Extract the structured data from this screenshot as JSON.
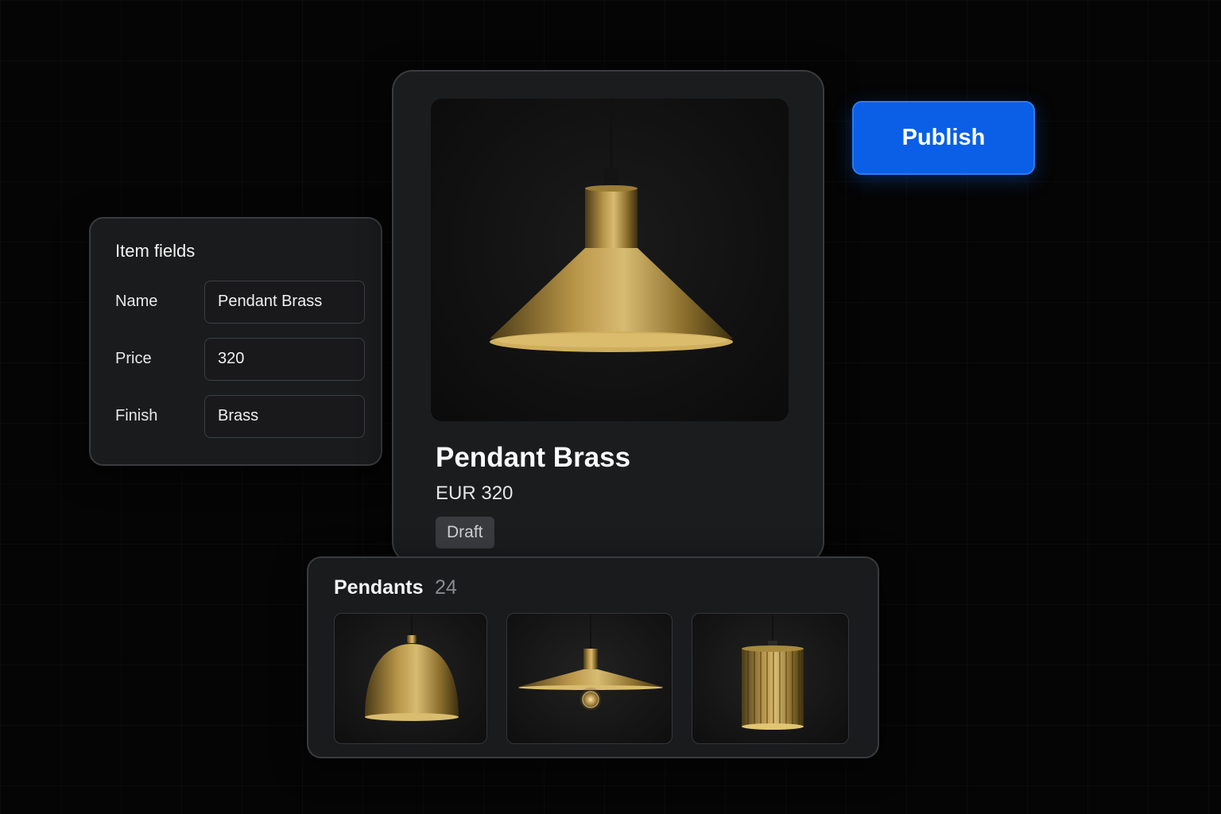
{
  "fields_panel": {
    "title": "Item fields",
    "rows": [
      {
        "label": "Name",
        "value": "Pendant Brass"
      },
      {
        "label": "Price",
        "value": "320"
      },
      {
        "label": "Finish",
        "value": "Brass"
      }
    ]
  },
  "product": {
    "name": "Pendant Brass",
    "price": "EUR 320",
    "status": "Draft",
    "image_icon": "pendant-lamp-cone-icon"
  },
  "publish": {
    "label": "Publish"
  },
  "collection": {
    "title": "Pendants",
    "count": "24",
    "items": [
      {
        "icon": "pendant-lamp-dome-icon"
      },
      {
        "icon": "pendant-lamp-flat-shade-icon"
      },
      {
        "icon": "pendant-lamp-fluted-cylinder-icon"
      }
    ]
  },
  "colors": {
    "background": "#050505",
    "panel": "#1a1b1d",
    "accent_blue": "#0a5fe6",
    "brass": "#b8963f",
    "badge": "#3a3b3f"
  }
}
